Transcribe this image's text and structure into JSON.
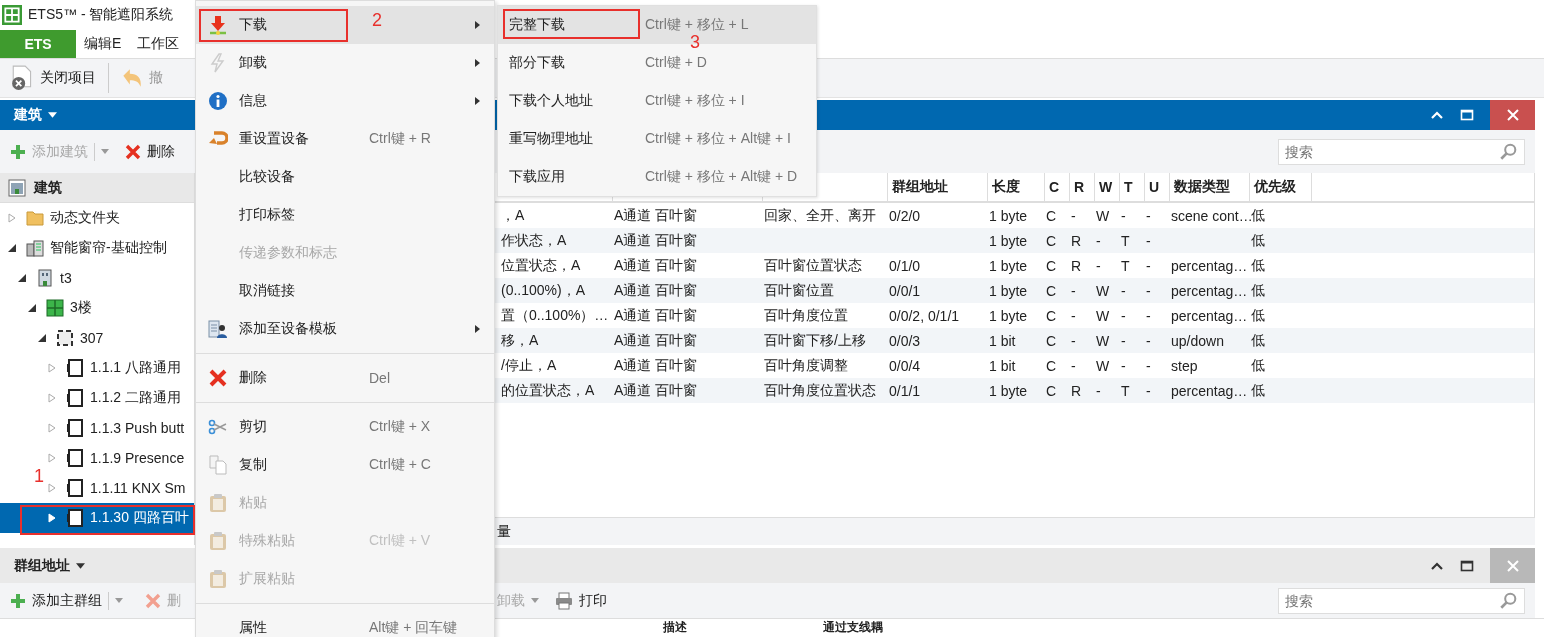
{
  "window": {
    "title": "ETS5™ - 智能遮阳系统"
  },
  "menubar": [
    {
      "label": "ETS",
      "selected": true
    },
    {
      "label": "编辑E",
      "selected": false
    },
    {
      "label": "工作区",
      "selected": false
    }
  ],
  "toolbar": [
    {
      "label": "关闭项目",
      "disabled": false
    },
    {
      "label": "撤",
      "disabled": true
    }
  ],
  "building_panel": {
    "title": "建筑",
    "toolbar": [
      {
        "label": "添加建筑",
        "disabled": true,
        "dropdown": true
      },
      {
        "label": "删除",
        "disabled": false,
        "dropdown": false
      }
    ],
    "search": {
      "placeholder": "搜索"
    }
  },
  "tree": {
    "header": "建筑",
    "items": [
      {
        "label": "动态文件夹",
        "kind": "folder",
        "expanded": false,
        "selected": false
      },
      {
        "label": "智能窗帘-基础控制",
        "kind": "project",
        "expanded": true,
        "selected": false,
        "children": [
          {
            "label": "t3",
            "kind": "building",
            "expanded": true,
            "selected": false,
            "children": [
              {
                "label": "3楼",
                "kind": "floor",
                "expanded": true,
                "selected": false,
                "children": [
                  {
                    "label": "307",
                    "kind": "room",
                    "expanded": true,
                    "selected": false,
                    "children": [
                      {
                        "label": "1.1.1 八路通用",
                        "kind": "device",
                        "expanded": false,
                        "selected": false
                      },
                      {
                        "label": "1.1.2 二路通用",
                        "kind": "device",
                        "expanded": false,
                        "selected": false
                      },
                      {
                        "label": "1.1.3 Push butt",
                        "kind": "device",
                        "expanded": false,
                        "selected": false
                      },
                      {
                        "label": "1.1.9 Presence",
                        "kind": "device",
                        "expanded": false,
                        "selected": false
                      },
                      {
                        "label": "1.1.11 KNX Sm",
                        "kind": "device",
                        "expanded": false,
                        "selected": false
                      },
                      {
                        "label": "1.1.30 四路百叶",
                        "kind": "device",
                        "expanded": false,
                        "selected": true
                      }
                    ]
                  }
                ]
              }
            ]
          }
        ]
      }
    ]
  },
  "table": {
    "headers": {
      "group_address": "群组地址",
      "length": "长度",
      "c": "C",
      "r": "R",
      "w": "W",
      "t": "T",
      "u": "U",
      "data_type": "数据类型",
      "priority": "优先级"
    },
    "rows": [
      {
        "column_1": "，A",
        "column_2": "A通道 百叶窗",
        "column_3": "回家、全开、离开",
        "group_address": "0/2/0",
        "length": "1 byte",
        "c": "C",
        "r": "-",
        "w": "W",
        "t": "-",
        "u": "-",
        "data_type": "scene cont…",
        "priority": "低"
      },
      {
        "column_1": "作状态，A",
        "column_2": "A通道 百叶窗",
        "length": "1 byte",
        "c": "C",
        "r": "R",
        "w": "-",
        "t": "T",
        "u": "-",
        "priority": "低"
      },
      {
        "column_1": "位置状态，A",
        "column_2": "A通道 百叶窗",
        "column_3": "百叶窗位置状态",
        "group_address": "0/1/0",
        "length": "1 byte",
        "c": "C",
        "r": "R",
        "w": "-",
        "t": "T",
        "u": "-",
        "data_type": "percentag…",
        "priority": "低"
      },
      {
        "column_1": "(0..100%)，A",
        "column_2": "A通道 百叶窗",
        "column_3": "百叶窗位置",
        "group_address": "0/0/1",
        "length": "1 byte",
        "c": "C",
        "r": "-",
        "w": "W",
        "t": "-",
        "u": "-",
        "data_type": "percentag…",
        "priority": "低"
      },
      {
        "column_1": "置（0..100%）…",
        "column_2": "A通道 百叶窗",
        "column_3": "百叶角度位置",
        "group_address": "0/0/2, 0/1/1",
        "length": "1 byte",
        "c": "C",
        "r": "-",
        "w": "W",
        "t": "-",
        "u": "-",
        "data_type": "percentag…",
        "priority": "低"
      },
      {
        "column_1": "移，A",
        "column_2": "A通道 百叶窗",
        "column_3": "百叶窗下移/上移",
        "group_address": "0/0/3",
        "length": "1 bit",
        "c": "C",
        "r": "-",
        "w": "W",
        "t": "-",
        "u": "-",
        "data_type": "up/down",
        "priority": "低"
      },
      {
        "column_1": "/停止，A",
        "column_2": "A通道 百叶窗",
        "column_3": "百叶角度调整",
        "group_address": "0/0/4",
        "length": "1 bit",
        "c": "C",
        "r": "-",
        "w": "W",
        "t": "-",
        "u": "-",
        "data_type": "step",
        "priority": "低"
      },
      {
        "column_1": "的位置状态，A",
        "column_2": "A通道 百叶窗",
        "column_3": "百叶角度位置状态",
        "group_address": "0/1/1",
        "length": "1 byte",
        "c": "C",
        "r": "R",
        "w": "-",
        "t": "T",
        "u": "-",
        "data_type": "percentag…",
        "priority": "低"
      }
    ]
  },
  "bottom_tabs": [
    {
      "label": "量"
    }
  ],
  "group_panel": {
    "title": "群组地址",
    "toolbar": [
      {
        "label": "添加主群组",
        "disabled": false,
        "dropdown": true
      },
      {
        "label": "删",
        "disabled": true,
        "dropdown": false
      },
      {
        "label": "卸载",
        "disabled": true,
        "dropdown": true
      },
      {
        "label": "打印",
        "disabled": false,
        "dropdown": false
      }
    ],
    "search": {
      "placeholder": "搜索"
    },
    "columns": [
      "描述",
      "通过支线耦"
    ]
  },
  "context_menu": {
    "groups": [
      [
        {
          "label": "下载",
          "submenu": true,
          "selected": true,
          "disabled": false
        },
        {
          "label": "卸载",
          "submenu": true,
          "selected": false,
          "disabled": false
        },
        {
          "label": "信息",
          "submenu": true,
          "selected": false,
          "disabled": false
        },
        {
          "label": "重设置设备",
          "shortcut": "Ctrl键 + R",
          "submenu": false,
          "selected": false,
          "disabled": false
        },
        {
          "label": "比较设备",
          "submenu": false,
          "selected": false,
          "disabled": false
        },
        {
          "label": "打印标签",
          "submenu": false,
          "selected": false,
          "disabled": false
        },
        {
          "label": "传递参数和标志",
          "submenu": false,
          "selected": false,
          "disabled": true
        },
        {
          "label": "取消链接",
          "submenu": false,
          "selected": false,
          "disabled": false
        },
        {
          "label": "添加至设备模板",
          "submenu": true,
          "selected": false,
          "disabled": false
        }
      ],
      [
        {
          "label": "删除",
          "shortcut": "Del",
          "submenu": false,
          "selected": false,
          "disabled": false
        }
      ],
      [
        {
          "label": "剪切",
          "shortcut": "Ctrl键 + X",
          "submenu": false,
          "selected": false,
          "disabled": false
        },
        {
          "label": "复制",
          "shortcut": "Ctrl键 + C",
          "submenu": false,
          "selected": false,
          "disabled": false
        },
        {
          "label": "粘贴",
          "submenu": false,
          "selected": false,
          "disabled": true
        },
        {
          "label": "特殊粘贴",
          "shortcut": "Ctrl键 + V",
          "submenu": false,
          "selected": false,
          "disabled": true
        },
        {
          "label": "扩展粘贴",
          "submenu": false,
          "selected": false,
          "disabled": true
        }
      ],
      [
        {
          "label": "属性",
          "shortcut": "Alt键 + 回车键",
          "submenu": false,
          "selected": false,
          "disabled": false
        }
      ]
    ]
  },
  "submenu": {
    "items": [
      {
        "label": "完整下载",
        "shortcut": "Ctrl键 + 移位 + L",
        "selected": true
      },
      {
        "label": "部分下载",
        "shortcut": "Ctrl键 + D",
        "selected": false
      },
      {
        "label": "下载个人地址",
        "shortcut": "Ctrl键 + 移位 + I",
        "selected": false
      },
      {
        "label": "重写物理地址",
        "shortcut": "Ctrl键 + 移位 + Alt键 + I",
        "selected": false
      },
      {
        "label": "下载应用",
        "shortcut": "Ctrl键 + 移位 + Alt键 + D",
        "selected": false
      }
    ]
  },
  "annotations": [
    {
      "label": "1"
    },
    {
      "label": "2"
    },
    {
      "label": "3"
    }
  ]
}
